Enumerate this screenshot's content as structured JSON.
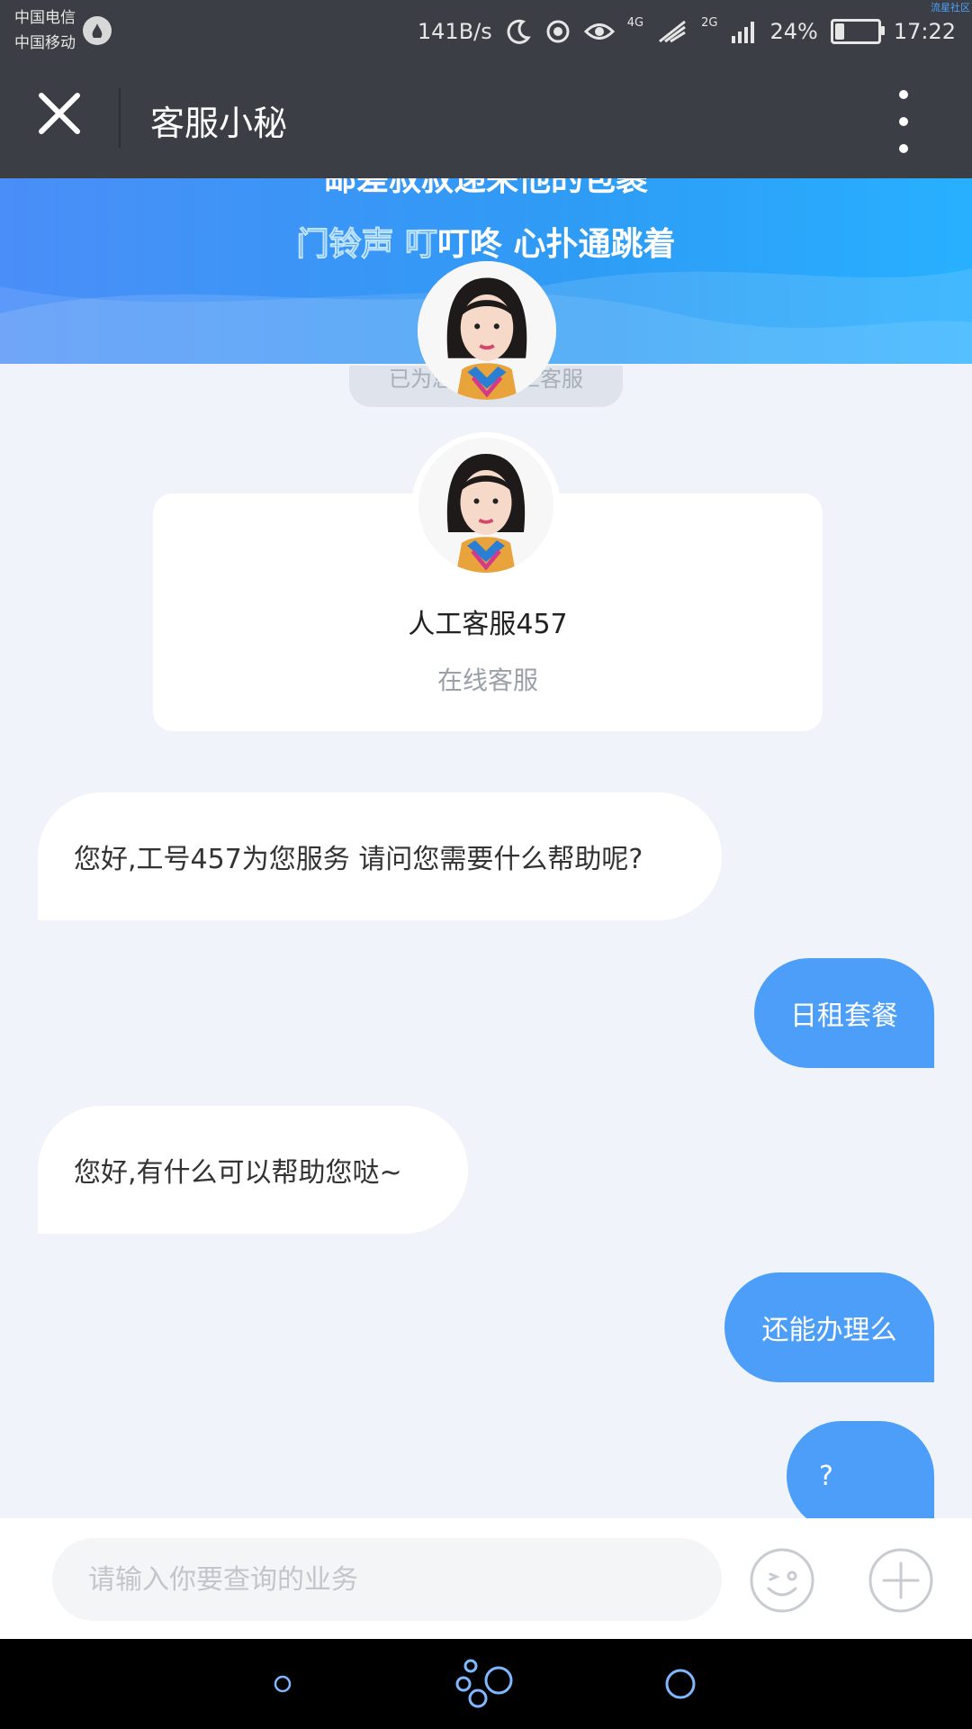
{
  "status_bar": {
    "carrier_1": "中国电信",
    "carrier_2": "中国移动",
    "net_speed": "141B/s",
    "net_4g": "4G",
    "net_2g": "2G",
    "battery_percent": "24%",
    "battery_level": 0.24,
    "time": "17:22",
    "watermark": "流星社区"
  },
  "header": {
    "title": "客服小秘"
  },
  "banner": {
    "lyric_line_1": "邮差叔叔递来他的包裹",
    "lyric_line_2_highlight": "门铃声 叮",
    "lyric_line_2_rest": "叮咚 心扑通跳着"
  },
  "toast": "已为您接入人工客服",
  "agent_card": {
    "name": "人工客服457",
    "status": "在线客服"
  },
  "messages": [
    {
      "from": "agent",
      "text": "您好,工号457为您服务 请问您需要什么帮助呢?"
    },
    {
      "from": "user",
      "text": "日租套餐"
    },
    {
      "from": "agent",
      "text": "您好,有什么可以帮助您哒~"
    },
    {
      "from": "user",
      "text": "还能办理么"
    },
    {
      "from": "user",
      "text": "?"
    }
  ],
  "input": {
    "placeholder": "请输入你要查询的业务"
  },
  "colors": {
    "header_bg": "#3b3e45",
    "banner_start": "#4a8ef8",
    "banner_end": "#28b0ff",
    "outgoing_bubble": "#4d9ef8",
    "chat_bg": "#f0f4fa"
  }
}
